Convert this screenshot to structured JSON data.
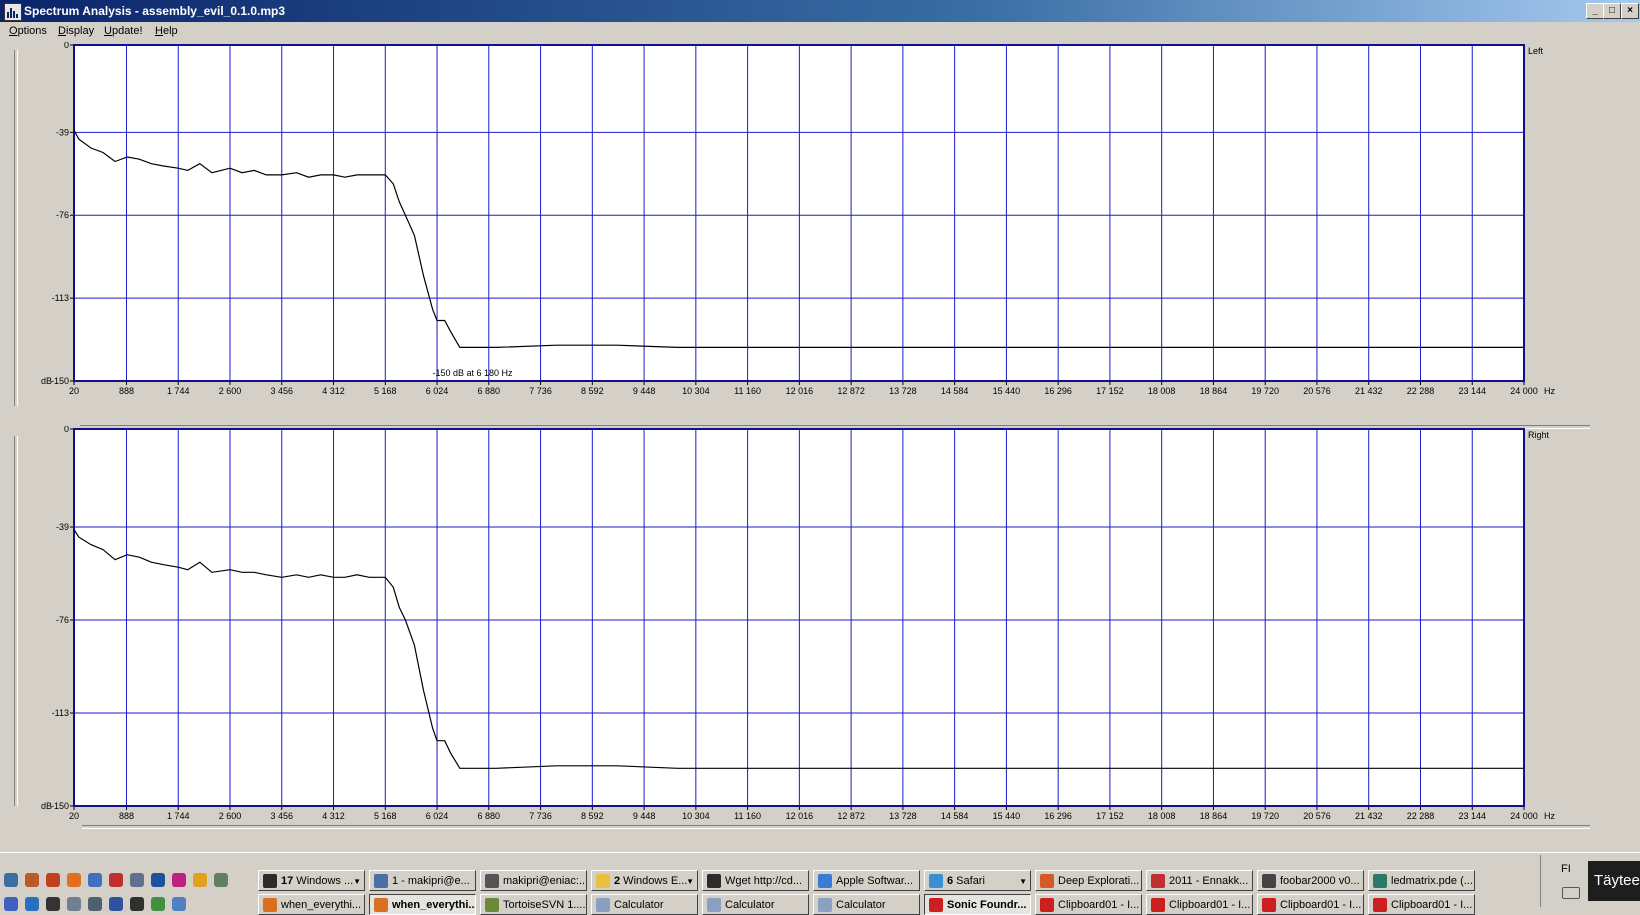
{
  "window": {
    "title": "Spectrum Analysis - assembly_evil_0.1.0.mp3",
    "minimize": "_",
    "maximize": "□",
    "close": "×"
  },
  "menu": [
    "Options",
    "Display",
    "Update!",
    "Help"
  ],
  "chart_data": [
    {
      "type": "line",
      "channel_label": "Left",
      "ylabel_unit": "dB",
      "xlabel_unit": "Hz",
      "y_ticks": [
        "0",
        "-39",
        "-76",
        "-113",
        "-150"
      ],
      "y_tick_values": [
        0,
        -39,
        -76,
        -113,
        -150
      ],
      "x_ticks": [
        "20",
        "888",
        "1 744",
        "2 600",
        "3 456",
        "4 312",
        "5 168",
        "6 024",
        "6 880",
        "7 736",
        "8 592",
        "9 448",
        "10 304",
        "11 160",
        "12 016",
        "12 872",
        "13 728",
        "14 584",
        "15 440",
        "16 296",
        "17 152",
        "18 008",
        "18 864",
        "19 720",
        "20 576",
        "21 432",
        "22 288",
        "23 144",
        "24 000"
      ],
      "x_tick_values": [
        20,
        888,
        1744,
        2600,
        3456,
        4312,
        5168,
        6024,
        6880,
        7736,
        8592,
        9448,
        10304,
        11160,
        12016,
        12872,
        13728,
        14584,
        15440,
        16296,
        17152,
        18008,
        18864,
        19720,
        20576,
        21432,
        22288,
        23144,
        24000
      ],
      "xlim": [
        20,
        24000
      ],
      "ylim": [
        -150,
        0
      ],
      "grid": true,
      "cursor_annotation": "-150 dB at 6 180 Hz",
      "series": [
        {
          "color": "#000000",
          "x": [
            20,
            100,
            300,
            500,
            700,
            900,
            1100,
            1300,
            1500,
            1744,
            1900,
            2100,
            2300,
            2600,
            2800,
            3000,
            3200,
            3456,
            3700,
            3900,
            4100,
            4312,
            4500,
            4700,
            4900,
            5168,
            5300,
            5400,
            5500,
            5650,
            5800,
            5950,
            6024,
            6150,
            6250,
            6400,
            7000,
            8000,
            9000,
            10000,
            11000,
            12000,
            14000,
            16000,
            18000,
            20000,
            22000,
            24000
          ],
          "y": [
            -38,
            -42,
            -46,
            -48,
            -52,
            -50,
            -51,
            -53,
            -54,
            -55,
            -56,
            -53,
            -57,
            -55,
            -57,
            -56,
            -58,
            -58,
            -57,
            -59,
            -58,
            -58,
            -59,
            -58,
            -58,
            -58,
            -62,
            -70,
            -76,
            -85,
            -103,
            -118,
            -123,
            -123,
            -128,
            -135,
            -135,
            -134,
            -134,
            -135,
            -135,
            -135,
            -135,
            -135,
            -135,
            -135,
            -135,
            -135
          ]
        }
      ]
    },
    {
      "type": "line",
      "channel_label": "Right",
      "ylabel_unit": "dB",
      "xlabel_unit": "Hz",
      "y_ticks": [
        "0",
        "-39",
        "-76",
        "-113",
        "-150"
      ],
      "y_tick_values": [
        0,
        -39,
        -76,
        -113,
        -150
      ],
      "x_ticks": [
        "20",
        "888",
        "1 744",
        "2 600",
        "3 456",
        "4 312",
        "5 168",
        "6 024",
        "6 880",
        "7 736",
        "8 592",
        "9 448",
        "10 304",
        "11 160",
        "12 016",
        "12 872",
        "13 728",
        "14 584",
        "15 440",
        "16 296",
        "17 152",
        "18 008",
        "18 864",
        "19 720",
        "20 576",
        "21 432",
        "22 288",
        "23 144",
        "24 000"
      ],
      "x_tick_values": [
        20,
        888,
        1744,
        2600,
        3456,
        4312,
        5168,
        6024,
        6880,
        7736,
        8592,
        9448,
        10304,
        11160,
        12016,
        12872,
        13728,
        14584,
        15440,
        16296,
        17152,
        18008,
        18864,
        19720,
        20576,
        21432,
        22288,
        23144,
        24000
      ],
      "xlim": [
        20,
        24000
      ],
      "ylim": [
        -150,
        0
      ],
      "grid": true,
      "series": [
        {
          "color": "#000000",
          "x": [
            20,
            100,
            300,
            500,
            700,
            900,
            1100,
            1300,
            1500,
            1744,
            1900,
            2100,
            2300,
            2600,
            2800,
            3000,
            3200,
            3456,
            3700,
            3900,
            4100,
            4312,
            4500,
            4700,
            4900,
            5168,
            5300,
            5400,
            5500,
            5650,
            5800,
            5950,
            6024,
            6150,
            6250,
            6400,
            7000,
            8000,
            9000,
            10000,
            11000,
            12000,
            14000,
            16000,
            18000,
            20000,
            22000,
            24000
          ],
          "y": [
            -40,
            -43,
            -46,
            -48,
            -52,
            -50,
            -51,
            -53,
            -54,
            -55,
            -56,
            -53,
            -57,
            -56,
            -57,
            -57,
            -58,
            -59,
            -58,
            -59,
            -58,
            -59,
            -59,
            -58,
            -59,
            -59,
            -63,
            -71,
            -76,
            -86,
            -104,
            -119,
            -124,
            -124,
            -129,
            -135,
            -135,
            -134,
            -134,
            -135,
            -135,
            -135,
            -135,
            -135,
            -135,
            -135,
            -135,
            -135
          ]
        }
      ]
    }
  ],
  "taskbar": {
    "row1": [
      {
        "count": "17",
        "label": " Windows ...",
        "color": "#2b2b2b",
        "grouped": true
      },
      {
        "label": "1 - makipri@e...",
        "color": "#4a6fa5"
      },
      {
        "label": "makipri@eniac:...",
        "color": "#555555"
      },
      {
        "count": "2",
        "label": " Windows E...",
        "color": "#e8c040",
        "grouped": true
      },
      {
        "label": "Wget http://cd...",
        "color": "#2b2b2b"
      },
      {
        "label": "Apple Softwar...",
        "color": "#3a7bd5"
      },
      {
        "count": "6",
        "label": " Safari",
        "color": "#3a8fd5",
        "grouped": true
      },
      {
        "label": "Deep Explorati...",
        "color": "#d55a2a"
      },
      {
        "label": "2011 - Ennakk...",
        "color": "#c03030"
      },
      {
        "label": "foobar2000 v0...",
        "color": "#444444"
      },
      {
        "label": "ledmatrix.pde (...",
        "color": "#2a7a6a"
      }
    ],
    "row2": [
      {
        "label": "when_everythi...",
        "color": "#d87020"
      },
      {
        "label": "when_everythi...",
        "color": "#d87020",
        "active": true
      },
      {
        "label": "TortoiseSVN 1....",
        "color": "#6a8a3a"
      },
      {
        "label": "Calculator",
        "color": "#8aa0c0"
      },
      {
        "label": "Calculator",
        "color": "#8aa0c0"
      },
      {
        "label": "Calculator",
        "color": "#8aa0c0"
      },
      {
        "label": "Sonic Foundr...",
        "color": "#cc2020",
        "active": true
      },
      {
        "label": "Clipboard01 - I...",
        "color": "#cc2020"
      },
      {
        "label": "Clipboard01 - I...",
        "color": "#cc2020"
      },
      {
        "label": "Clipboard01 - I...",
        "color": "#cc2020"
      },
      {
        "label": "Clipboard01 - I...",
        "color": "#cc2020"
      }
    ],
    "language": "FI",
    "show_desktop": "Täytee"
  }
}
